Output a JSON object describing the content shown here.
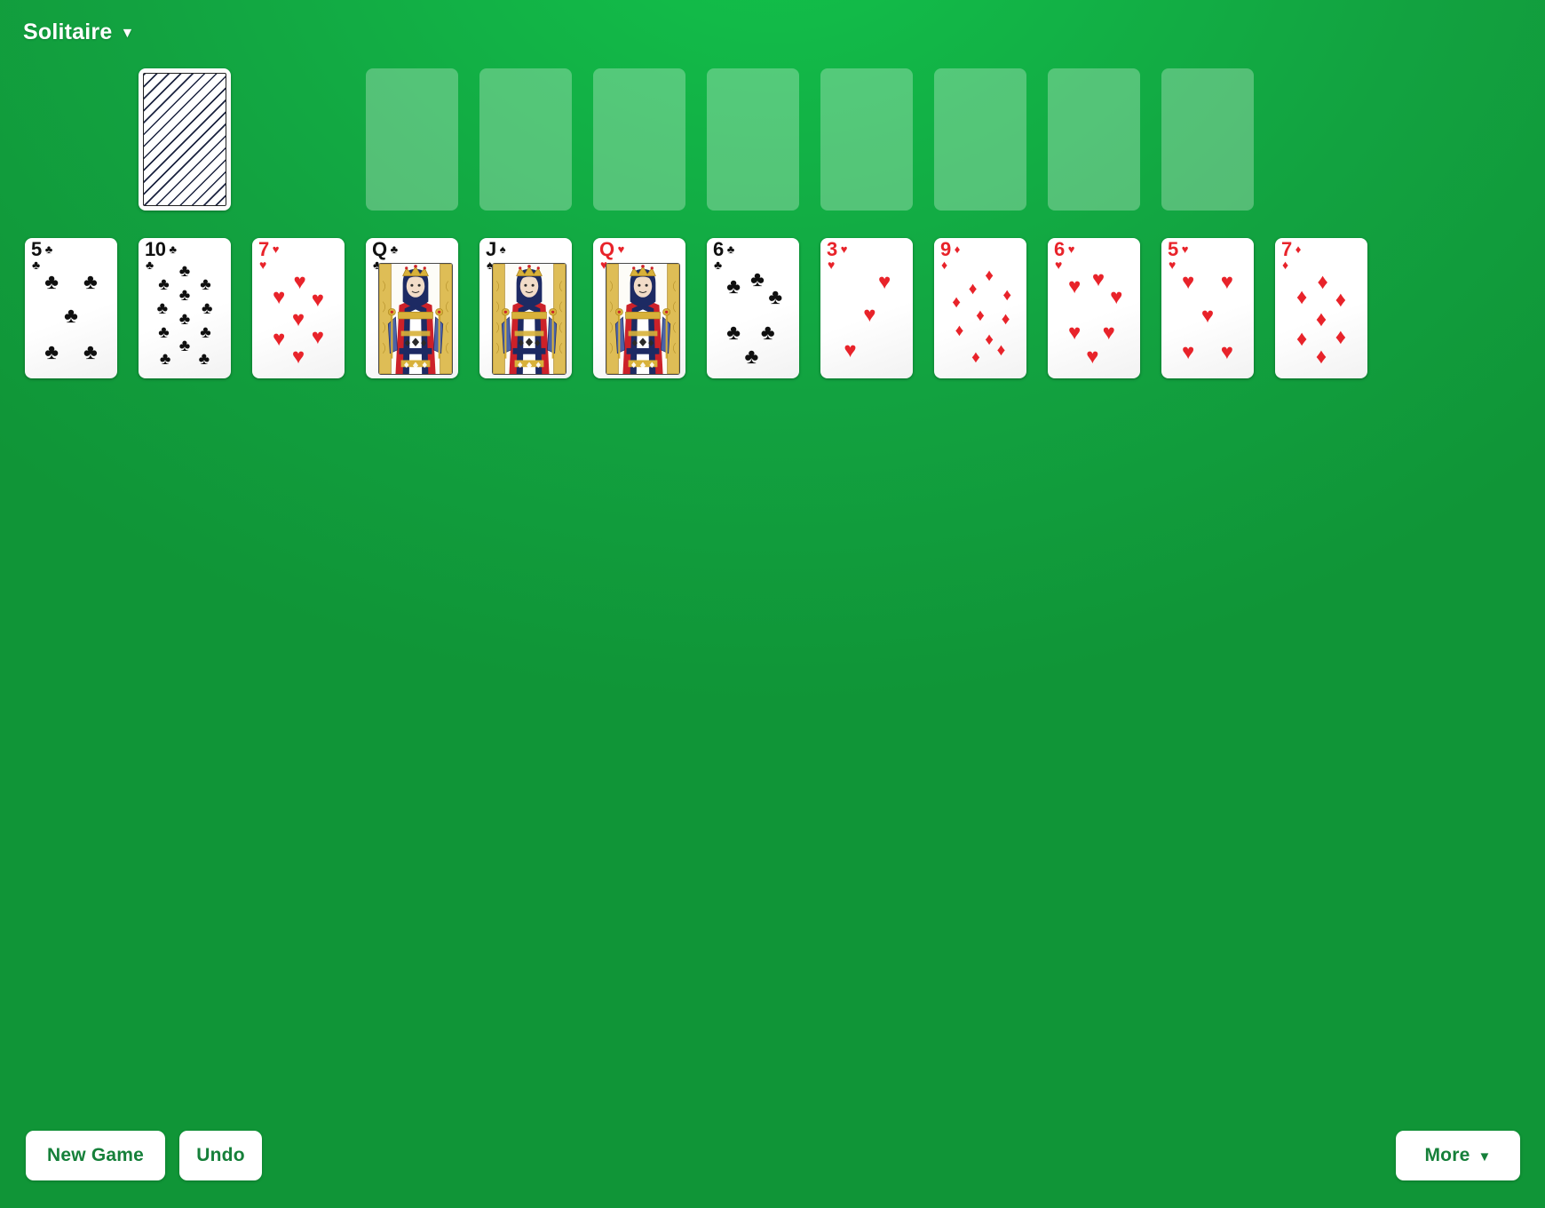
{
  "app": {
    "title": "Solitaire",
    "title_caret": "▼",
    "background_color": "#12a240",
    "empty_slot_color": "rgba(255,255,255,0.28)",
    "red_suit_color": "#e8232a",
    "black_suit_color": "#101010",
    "button_text_color": "#16803a"
  },
  "suits": {
    "hearts": "♥",
    "diamonds": "♦",
    "clubs": "♣",
    "spades": "♠"
  },
  "board": {
    "stock": {
      "name": "stock-pile",
      "face_down": true,
      "count_visible": 1
    },
    "waste": {
      "name": "waste-pile",
      "empty": true
    },
    "foundations": [
      {
        "index": 0,
        "empty": true
      },
      {
        "index": 1,
        "empty": true
      },
      {
        "index": 2,
        "empty": true
      },
      {
        "index": 3,
        "empty": true
      },
      {
        "index": 4,
        "empty": true
      },
      {
        "index": 5,
        "empty": true
      },
      {
        "index": 6,
        "empty": true
      },
      {
        "index": 7,
        "empty": true
      }
    ],
    "tableau": [
      {
        "column": 1,
        "rank": "5",
        "suit": "clubs",
        "suit_symbol": "♣",
        "color": "black",
        "face_up": true
      },
      {
        "column": 2,
        "rank": "10",
        "suit": "clubs",
        "suit_symbol": "♣",
        "color": "black",
        "face_up": true
      },
      {
        "column": 3,
        "rank": "7",
        "suit": "hearts",
        "suit_symbol": "♥",
        "color": "red",
        "face_up": true
      },
      {
        "column": 4,
        "rank": "Q",
        "suit": "clubs",
        "suit_symbol": "♣",
        "color": "black",
        "face_up": true
      },
      {
        "column": 5,
        "rank": "J",
        "suit": "spades",
        "suit_symbol": "♠",
        "color": "black",
        "face_up": true
      },
      {
        "column": 6,
        "rank": "Q",
        "suit": "hearts",
        "suit_symbol": "♥",
        "color": "red",
        "face_up": true
      },
      {
        "column": 7,
        "rank": "6",
        "suit": "clubs",
        "suit_symbol": "♣",
        "color": "black",
        "face_up": true
      },
      {
        "column": 8,
        "rank": "3",
        "suit": "hearts",
        "suit_symbol": "♥",
        "color": "red",
        "face_up": true
      },
      {
        "column": 9,
        "rank": "9",
        "suit": "diamonds",
        "suit_symbol": "♦",
        "color": "red",
        "face_up": true
      },
      {
        "column": 10,
        "rank": "6",
        "suit": "hearts",
        "suit_symbol": "♥",
        "color": "red",
        "face_up": true
      },
      {
        "column": 11,
        "rank": "5",
        "suit": "hearts",
        "suit_symbol": "♥",
        "color": "red",
        "face_up": true
      },
      {
        "column": 12,
        "rank": "7",
        "suit": "diamonds",
        "suit_symbol": "♦",
        "color": "red",
        "face_up": true
      }
    ]
  },
  "footer": {
    "new_game_label": "New Game",
    "undo_label": "Undo",
    "more_label": "More",
    "more_caret": "▼"
  }
}
